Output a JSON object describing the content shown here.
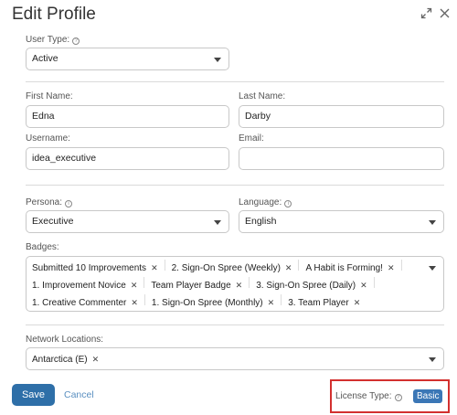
{
  "title": "Edit Profile",
  "user_type": {
    "label": "User Type:",
    "value": "Active"
  },
  "first_name": {
    "label": "First Name:",
    "value": "Edna"
  },
  "last_name": {
    "label": "Last Name:",
    "value": "Darby"
  },
  "username": {
    "label": "Username:",
    "value": "idea_executive"
  },
  "email": {
    "label": "Email:",
    "value": ""
  },
  "persona": {
    "label": "Persona:",
    "value": "Executive"
  },
  "language": {
    "label": "Language:",
    "value": "English"
  },
  "badges": {
    "label": "Badges:",
    "items": [
      "Submitted 10 Improvements",
      "2. Sign-On Spree (Weekly)",
      "A Habit is Forming!",
      "1. Improvement Novice",
      "Team Player Badge",
      "3. Sign-On Spree (Daily)",
      "1. Creative Commenter",
      "1. Sign-On Spree (Monthly)",
      "3. Team Player"
    ]
  },
  "network_locations": {
    "label": "Network Locations:",
    "items": [
      "Antarctica (E)"
    ]
  },
  "actions": {
    "save": "Save",
    "cancel": "Cancel"
  },
  "license": {
    "label": "License Type:",
    "value": "Basic"
  },
  "icons": {
    "expand": "expand-icon",
    "close": "close-icon",
    "info": "info-icon",
    "dropdown": "caret-down-icon",
    "remove": "remove-tag-icon"
  },
  "colors": {
    "primary": "#2e6fa8",
    "badge": "#3b77b6",
    "highlight": "#d3302f",
    "link": "#5a8fc0"
  }
}
